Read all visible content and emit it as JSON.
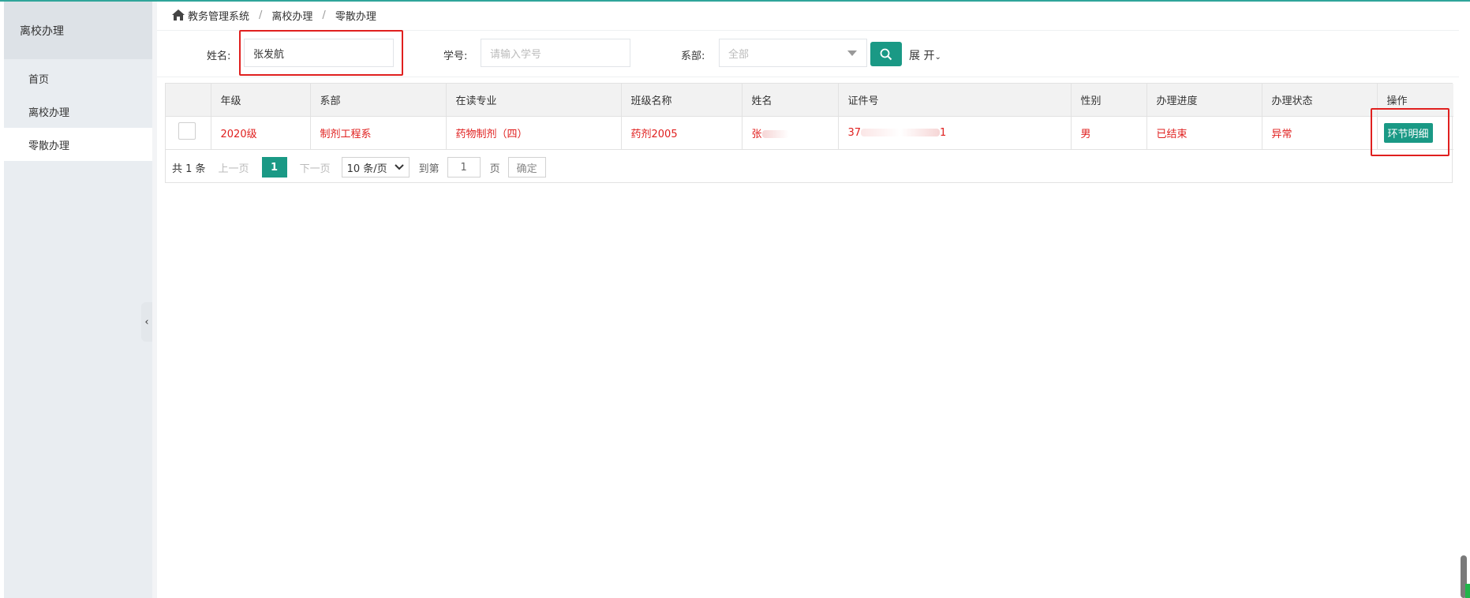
{
  "sidebar": {
    "header": "离校办理",
    "items": [
      {
        "label": "首页",
        "active": false
      },
      {
        "label": "离校办理",
        "active": false
      },
      {
        "label": "零散办理",
        "active": true
      }
    ],
    "collapse_icon": "chevron-left-icon"
  },
  "breadcrumb": {
    "home_icon": "home-icon",
    "items": [
      "教务管理系统",
      "离校办理",
      "零散办理"
    ],
    "separator": "/"
  },
  "search_form": {
    "name_label": "姓名:",
    "name_value": "张发航",
    "student_id_label": "学号:",
    "student_id_placeholder": "请输入学号",
    "department_label": "系部:",
    "department_value": "全部",
    "search_icon": "search-icon",
    "expand_label": "展 开",
    "expand_icon": "chevron-down-icon"
  },
  "table": {
    "columns": [
      "",
      "年级",
      "系部",
      "在读专业",
      "班级名称",
      "姓名",
      "证件号",
      "性别",
      "办理进度",
      "办理状态",
      "操作"
    ],
    "rows": [
      {
        "grade": "2020级",
        "department": "制剂工程系",
        "major": "药物制剂（四）",
        "class_name": "药剂2005",
        "name": "张",
        "id_number": "37",
        "id_number_tail": "1",
        "gender": "男",
        "progress": "已结束",
        "status": "异常",
        "action_label": "环节明细"
      }
    ]
  },
  "pagination": {
    "total": "共 1 条",
    "prev": "上一页",
    "current_page": "1",
    "next": "下一页",
    "page_size": "10 条/页",
    "goto_label": "到第",
    "goto_value": "1",
    "page_unit": "页",
    "confirm": "确定"
  },
  "colors": {
    "accent": "#1a9985",
    "highlight_red": "#e0201f",
    "sidebar_bg": "#e9edf1"
  }
}
